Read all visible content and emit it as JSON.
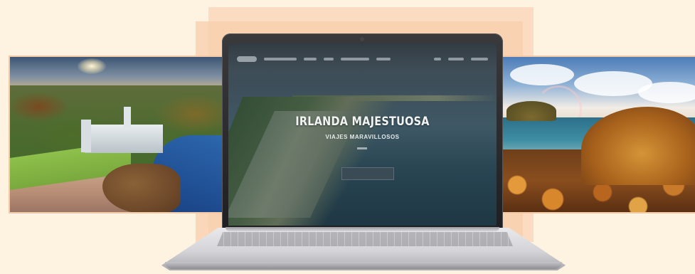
{
  "hero": {
    "title": "IRLANDA MAJESTUOSA",
    "subtitle": "VIAJES MARAVILLOSOS"
  },
  "colors": {
    "background": "#fdf3e0",
    "backdrop": "#fbdcc3",
    "photo_border": "#f4c9a6",
    "laptop_body": "#2b2b2d",
    "cta_background": "#3a4b55"
  },
  "icons": {
    "laptop": "laptop-icon",
    "camera": "camera-icon"
  }
}
